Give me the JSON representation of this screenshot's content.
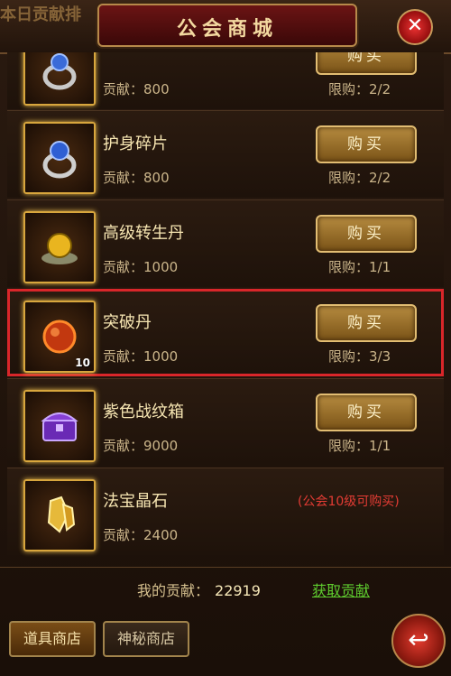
{
  "header": {
    "bg_text": "本日贡献排",
    "title": "公会商城",
    "close_label": "✕"
  },
  "items": [
    {
      "name": "",
      "contribution": "贡献：800",
      "limit": "限购：2/2",
      "button": "购买",
      "icon": "ring-icon"
    },
    {
      "name": "护身碎片",
      "contribution": "贡献：800",
      "limit": "限购：2/2",
      "button": "购买",
      "icon": "ring-icon"
    },
    {
      "name": "高级转生丹",
      "contribution": "贡献：1000",
      "limit": "限购：1/1",
      "button": "购买",
      "icon": "golden-pill-icon"
    },
    {
      "name": "突破丹",
      "contribution": "贡献：1000",
      "limit": "限购：3/3",
      "button": "购买",
      "icon": "red-pill-icon",
      "quantity": "10"
    },
    {
      "name": "紫色战纹箱",
      "contribution": "贡献：9000",
      "limit": "限购：1/1",
      "button": "购买",
      "icon": "purple-chest-icon"
    },
    {
      "name": "法宝晶石",
      "contribution": "贡献：2400",
      "note": "(公会10级可购买)",
      "icon": "crystal-icon"
    }
  ],
  "footer": {
    "my_contrib_label": "我的贡献：",
    "my_contrib_value": "22919",
    "get_contrib": "获取贡献"
  },
  "nav": {
    "item_shop": "道具商店",
    "mystery_shop": "神秘商店",
    "back_label": "↩"
  },
  "colors": {
    "highlight": "#d9262a",
    "accent_gold": "#d8a63d",
    "link_green": "#5ecb2e",
    "note_red": "#e43c34"
  }
}
